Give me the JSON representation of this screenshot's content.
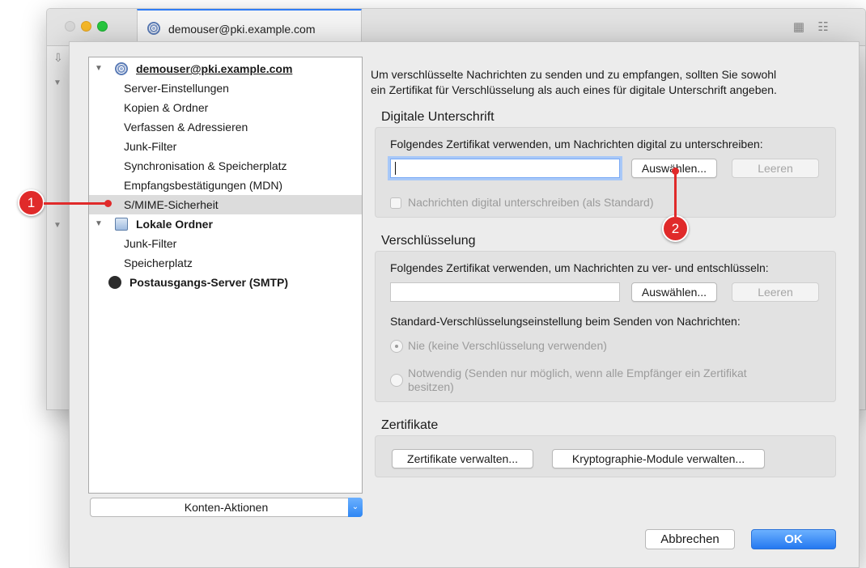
{
  "background_window": {
    "tab_title": "demouser@pki.example.com"
  },
  "sidebar": {
    "account": "demouser@pki.example.com",
    "account_items": [
      "Server-Einstellungen",
      "Kopien & Ordner",
      "Verfassen & Adressieren",
      "Junk-Filter",
      "Synchronisation & Speicherplatz",
      "Empfangsbestätigungen (MDN)",
      "S/MIME-Sicherheit"
    ],
    "local_folders": "Lokale Ordner",
    "local_items": [
      "Junk-Filter",
      "Speicherplatz"
    ],
    "smtp": "Postausgangs-Server (SMTP)",
    "selected": "S/MIME-Sicherheit",
    "account_actions": "Konten-Aktionen"
  },
  "main": {
    "intro_line1": "Um verschlüsselte Nachrichten zu senden und zu empfangen, sollten Sie sowohl",
    "intro_line2": "ein Zertifikat für Verschlüsselung als auch eines für digitale Unterschrift angeben.",
    "signature": {
      "title": "Digitale Unterschrift",
      "label": "Folgendes Zertifikat verwenden, um Nachrichten digital zu unterschreiben:",
      "field_value": "",
      "select_button": "Auswählen...",
      "clear_button": "Leeren",
      "checkbox_label": "Nachrichten digital unterschreiben (als Standard)"
    },
    "encryption": {
      "title": "Verschlüsselung",
      "label": "Folgendes Zertifikat verwenden, um Nachrichten zu ver- und entschlüsseln:",
      "field_value": "",
      "select_button": "Auswählen...",
      "clear_button": "Leeren",
      "default_label": "Standard-Verschlüsselungseinstellung beim Senden von Nachrichten:",
      "option_never": "Nie (keine Verschlüsselung verwenden)",
      "option_required_line1": "Notwendig (Senden nur möglich, wenn alle Empfänger ein Zertifikat",
      "option_required_line2": "besitzen)"
    },
    "certificates": {
      "title": "Zertifikate",
      "manage_button": "Zertifikate verwalten...",
      "modules_button": "Kryptographie-Module verwalten..."
    }
  },
  "footer": {
    "cancel": "Abbrechen",
    "ok": "OK"
  },
  "callouts": [
    "1",
    "2"
  ],
  "colors": {
    "accent": "#2e86f3",
    "callout": "#e02a2a",
    "selection": "#dcdcdc"
  }
}
